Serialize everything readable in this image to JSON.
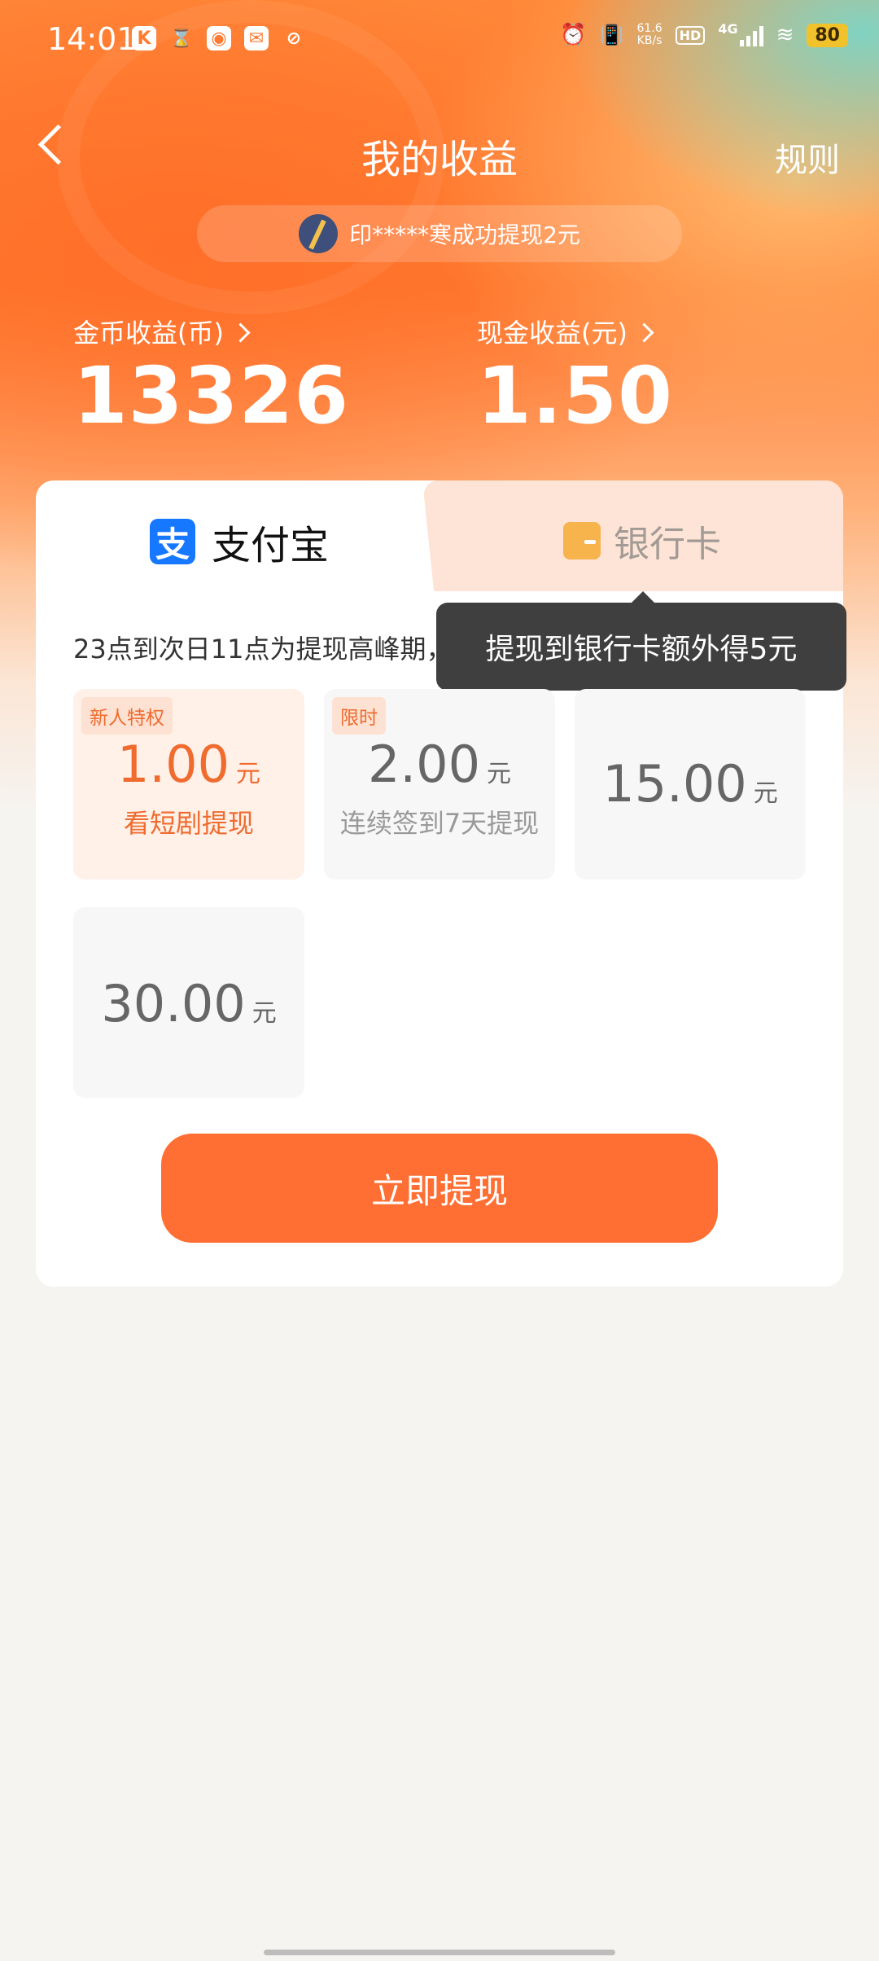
{
  "status_bar": {
    "time": "14:01",
    "app_icons": [
      "K",
      "⌛",
      "◉",
      "✉",
      "⊘"
    ],
    "net_speed_value": "61.6",
    "net_speed_unit": "KB/s",
    "hd_label": "HD",
    "network": "4G",
    "battery": "80"
  },
  "header": {
    "title": "我的收益",
    "rules_label": "规则"
  },
  "ticker": {
    "text": "印*****寒成功提现2元"
  },
  "earnings": {
    "coin_label": "金币收益(币)",
    "coin_value": "13326",
    "cash_label": "现金收益(元)",
    "cash_value": "1.50"
  },
  "tabs": {
    "alipay_icon": "支",
    "alipay_label": "支付宝",
    "bank_label": "银行卡"
  },
  "tooltip": {
    "text": "提现到银行卡额外得5元"
  },
  "notice": "23点到次日11点为提现高峰期，",
  "options": [
    {
      "badge": "新人特权",
      "amount": "1.00",
      "unit": "元",
      "sub": "看短剧提现",
      "selected": true
    },
    {
      "badge": "限时",
      "amount": "2.00",
      "unit": "元",
      "sub": "连续签到7天提现",
      "selected": false
    },
    {
      "badge": "",
      "amount": "15.00",
      "unit": "元",
      "sub": "",
      "selected": false
    },
    {
      "badge": "",
      "amount": "30.00",
      "unit": "元",
      "sub": "",
      "selected": false
    }
  ],
  "withdraw_button": "立即提现",
  "colors": {
    "accent": "#ff6e33",
    "alipay_blue": "#1677ff",
    "selected_text": "#f06b2e",
    "tooltip_bg": "#3f3f3f"
  }
}
